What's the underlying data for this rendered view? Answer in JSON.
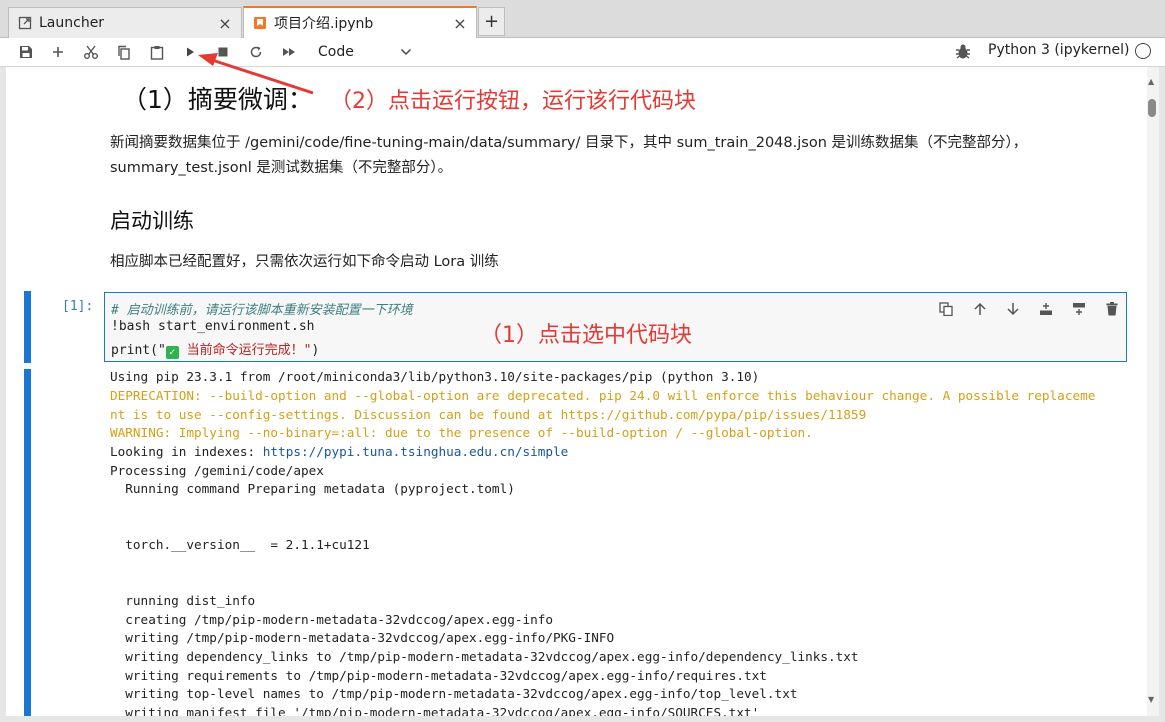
{
  "tabs": [
    {
      "label": "Launcher",
      "close": "×"
    },
    {
      "label": "项目介绍.ipynb",
      "close": "×"
    }
  ],
  "add_tab": "+",
  "toolbar": {
    "cell_type": "Code",
    "kernel_name": "Python 3 (ipykernel)"
  },
  "markdown": {
    "heading": "（1）摘要微调：",
    "para1_line1": "新闻摘要数据集位于 /gemini/code/fine-tuning-main/data/summary/ 目录下，其中 sum_train_2048.json 是训练数据集（不完整部分），",
    "para1_line2": "summary_test.jsonl 是测试数据集（不完整部分）。",
    "subheading": "启动训练",
    "para2": "相应脚本已经配置好，只需依次运行如下命令启动 Lora 训练"
  },
  "code_cell": {
    "prompt": "[1]:",
    "line1": "# 启动训练前，请运行该脚本重新安装配置一下环境",
    "line2": "!bash start_environment.sh",
    "line3_pre": "print(\"",
    "line3_check": "✓",
    "line3_str": " 当前命令运行完成！\"",
    "line3_post": ")"
  },
  "output": {
    "l1": "Using pip 23.3.1 from /root/miniconda3/lib/python3.10/site-packages/pip (python 3.10)",
    "l2": "DEPRECATION: --build-option and --global-option are deprecated. pip 24.0 will enforce this behaviour change. A possible replaceme",
    "l3": "nt is to use --config-settings. Discussion can be found at https://github.com/pypa/pip/issues/11859",
    "l4": "WARNING: Implying --no-binary=:all: due to the presence of --build-option / --global-option.",
    "l5_pre": "Looking in indexes: ",
    "l5_link": "https://pypi.tuna.tsinghua.edu.cn/simple",
    "l6": "Processing /gemini/code/apex",
    "l7": "  Running command Preparing metadata (pyproject.toml)",
    "l8": "  torch.__version__  = 2.1.1+cu121",
    "l9": "  running dist_info",
    "l10": "  creating /tmp/pip-modern-metadata-32vdccog/apex.egg-info",
    "l11": "  writing /tmp/pip-modern-metadata-32vdccog/apex.egg-info/PKG-INFO",
    "l12": "  writing dependency_links to /tmp/pip-modern-metadata-32vdccog/apex.egg-info/dependency_links.txt",
    "l13": "  writing requirements to /tmp/pip-modern-metadata-32vdccog/apex.egg-info/requires.txt",
    "l14": "  writing top-level names to /tmp/pip-modern-metadata-32vdccog/apex.egg-info/top_level.txt",
    "l15": "  writing manifest file '/tmp/pip-modern-metadata-32vdccog/apex.egg-info/SOURCES.txt'"
  },
  "annotations": {
    "run_hint": "（2）点击运行按钮，运行该行代码块",
    "select_hint": "（1）点击选中代码块",
    "color": "#e53935"
  },
  "icons": [
    "launcher-icon",
    "notebook-icon",
    "save-icon",
    "add-cell-icon",
    "cut-icon",
    "copy-icon",
    "paste-icon",
    "run-icon",
    "stop-icon",
    "restart-icon",
    "fast-forward-icon",
    "chevron-down-icon",
    "bug-icon",
    "kernel-status-icon",
    "duplicate-icon",
    "move-up-icon",
    "move-down-icon",
    "insert-above-icon",
    "insert-below-icon",
    "delete-icon"
  ]
}
